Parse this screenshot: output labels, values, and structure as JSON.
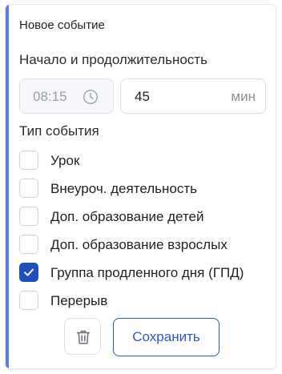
{
  "card": {
    "title": "Новое событие"
  },
  "timing": {
    "label": "Начало и продолжительность",
    "start_time": "08:15",
    "start_icon": "clock-icon",
    "duration_value": "45",
    "duration_unit": "мин"
  },
  "event_type": {
    "label": "Тип события",
    "options": [
      {
        "label": "Урок",
        "checked": false
      },
      {
        "label": "Внеуроч. деятельность",
        "checked": false
      },
      {
        "label": "Доп. образование детей",
        "checked": false
      },
      {
        "label": "Доп. образование взрослых",
        "checked": false
      },
      {
        "label": "Группа продленного дня (ГПД)",
        "checked": true
      },
      {
        "label": "Перерыв",
        "checked": false
      }
    ]
  },
  "actions": {
    "delete_icon": "trash-icon",
    "save_label": "Сохранить"
  },
  "colors": {
    "accent": "#5b7cf0",
    "primary": "#2f56c9",
    "checkbox_checked": "#1d4fbf"
  }
}
